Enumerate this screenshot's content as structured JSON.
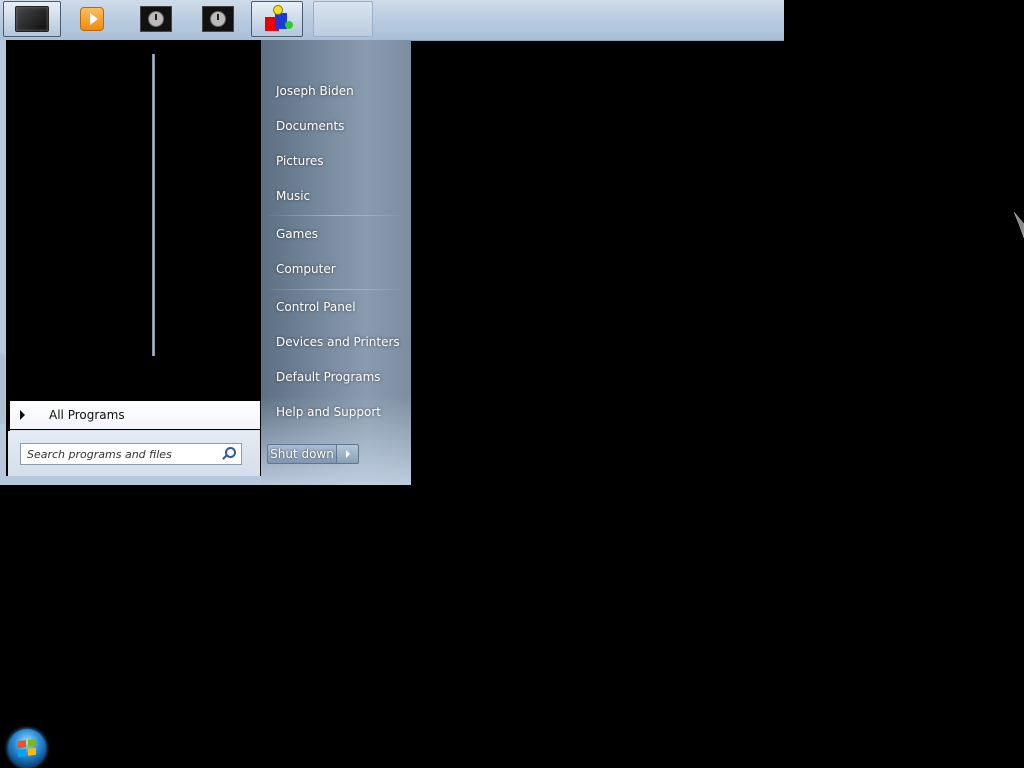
{
  "taskbar": {
    "items": [
      {
        "name": "terminal-window",
        "state": "active",
        "icon": "terminal-icon"
      },
      {
        "name": "media-player",
        "state": "normal",
        "icon": "media-player-icon"
      },
      {
        "name": "clock-window-1",
        "state": "normal",
        "icon": "clock-icon"
      },
      {
        "name": "clock-window-2",
        "state": "normal",
        "icon": "clock-icon"
      },
      {
        "name": "blocks-app",
        "state": "active",
        "icon": "blocks-icon"
      },
      {
        "name": "empty-button",
        "state": "normal",
        "icon": ""
      }
    ]
  },
  "start_menu": {
    "all_programs_label": "All Programs",
    "search": {
      "placeholder": "Search programs and files",
      "value": ""
    },
    "right_items": [
      {
        "label": "Joseph Biden"
      },
      {
        "label": "Documents"
      },
      {
        "label": "Pictures"
      },
      {
        "label": "Music"
      },
      {
        "label": "Games"
      },
      {
        "label": "Computer"
      },
      {
        "label": "Control Panel"
      },
      {
        "label": "Devices and Printers"
      },
      {
        "label": "Default Programs"
      },
      {
        "label": "Help and Support"
      }
    ],
    "shutdown_label": "Shut down"
  },
  "colors": {
    "taskbar": "#b9cbe0",
    "right_pane": "#7a8ca0",
    "desktop": "#000000"
  }
}
